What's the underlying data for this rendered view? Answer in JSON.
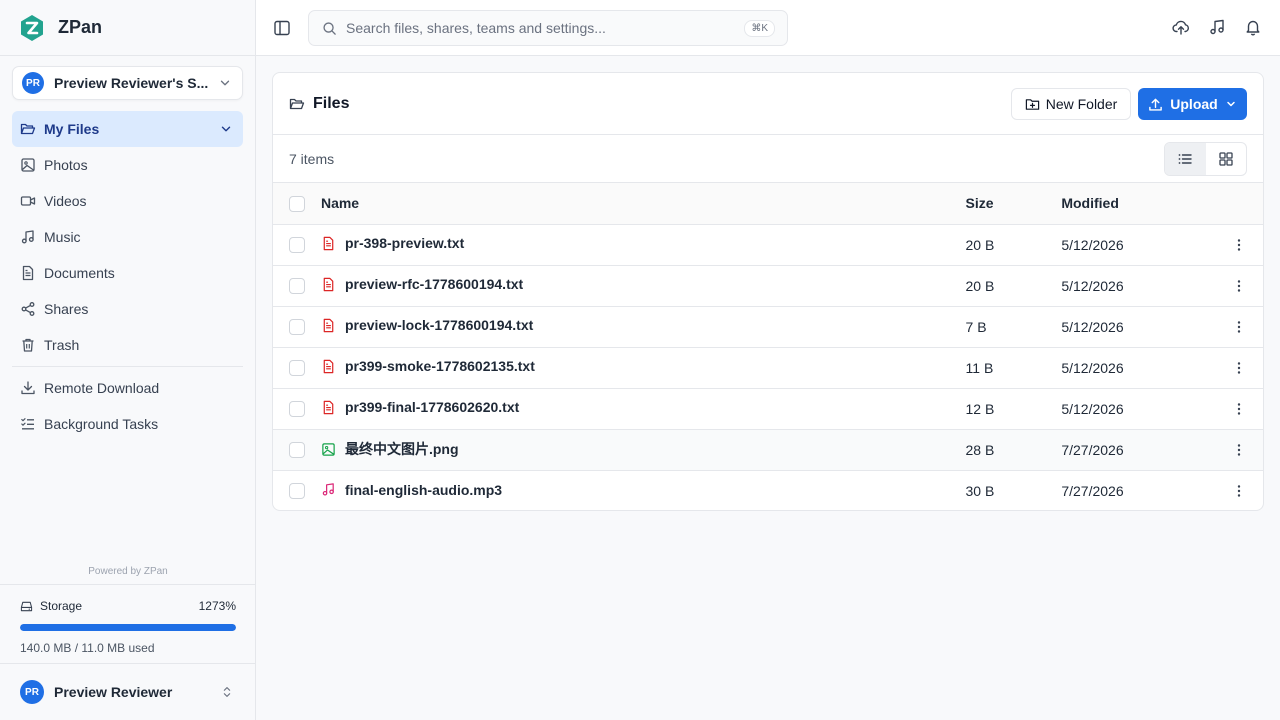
{
  "app": {
    "name": "ZPan",
    "brand_color": "#22a38f"
  },
  "workspace": {
    "initials": "PR",
    "name": "Preview Reviewer's S..."
  },
  "nav": {
    "items": [
      {
        "label": "My Files",
        "icon": "folder-open-icon"
      },
      {
        "label": "Photos",
        "icon": "image-icon"
      },
      {
        "label": "Videos",
        "icon": "video-icon"
      },
      {
        "label": "Music",
        "icon": "music-icon"
      },
      {
        "label": "Documents",
        "icon": "document-icon"
      },
      {
        "label": "Shares",
        "icon": "share-icon"
      },
      {
        "label": "Trash",
        "icon": "trash-icon"
      }
    ],
    "extra": [
      {
        "label": "Remote Download",
        "icon": "download-icon"
      },
      {
        "label": "Background Tasks",
        "icon": "tasks-icon"
      }
    ]
  },
  "powered": "Powered by ZPan",
  "storage": {
    "label": "Storage",
    "percent_label": "1273%",
    "fill_fraction": 1.0,
    "used_text": "140.0 MB / 11.0 MB used"
  },
  "user": {
    "initials": "PR",
    "name": "Preview Reviewer"
  },
  "search": {
    "placeholder": "Search files, shares, teams and settings...",
    "shortcut": "⌘K"
  },
  "page": {
    "title": "Files",
    "new_folder_label": "New Folder",
    "upload_label": "Upload",
    "items_count": "7 items"
  },
  "table": {
    "columns": {
      "name": "Name",
      "size": "Size",
      "modified": "Modified"
    },
    "rows": [
      {
        "name": "pr-398-preview.txt",
        "size": "20 B",
        "modified": "5/12/2026",
        "type": "text"
      },
      {
        "name": "preview-rfc-1778600194.txt",
        "size": "20 B",
        "modified": "5/12/2026",
        "type": "text"
      },
      {
        "name": "preview-lock-1778600194.txt",
        "size": "7 B",
        "modified": "5/12/2026",
        "type": "text"
      },
      {
        "name": "pr399-smoke-1778602135.txt",
        "size": "11 B",
        "modified": "5/12/2026",
        "type": "text"
      },
      {
        "name": "pr399-final-1778602620.txt",
        "size": "12 B",
        "modified": "5/12/2026",
        "type": "text"
      },
      {
        "name": "最终中文图片.png",
        "size": "28 B",
        "modified": "7/27/2026",
        "type": "image"
      },
      {
        "name": "final-english-audio.mp3",
        "size": "30 B",
        "modified": "7/27/2026",
        "type": "audio"
      }
    ]
  },
  "colors": {
    "accent": "#1f6fe5",
    "active_nav_bg": "#dbeafe",
    "text_file_icon": "#dc2626",
    "image_file_icon": "#16a34a",
    "audio_file_icon": "#db2777"
  }
}
